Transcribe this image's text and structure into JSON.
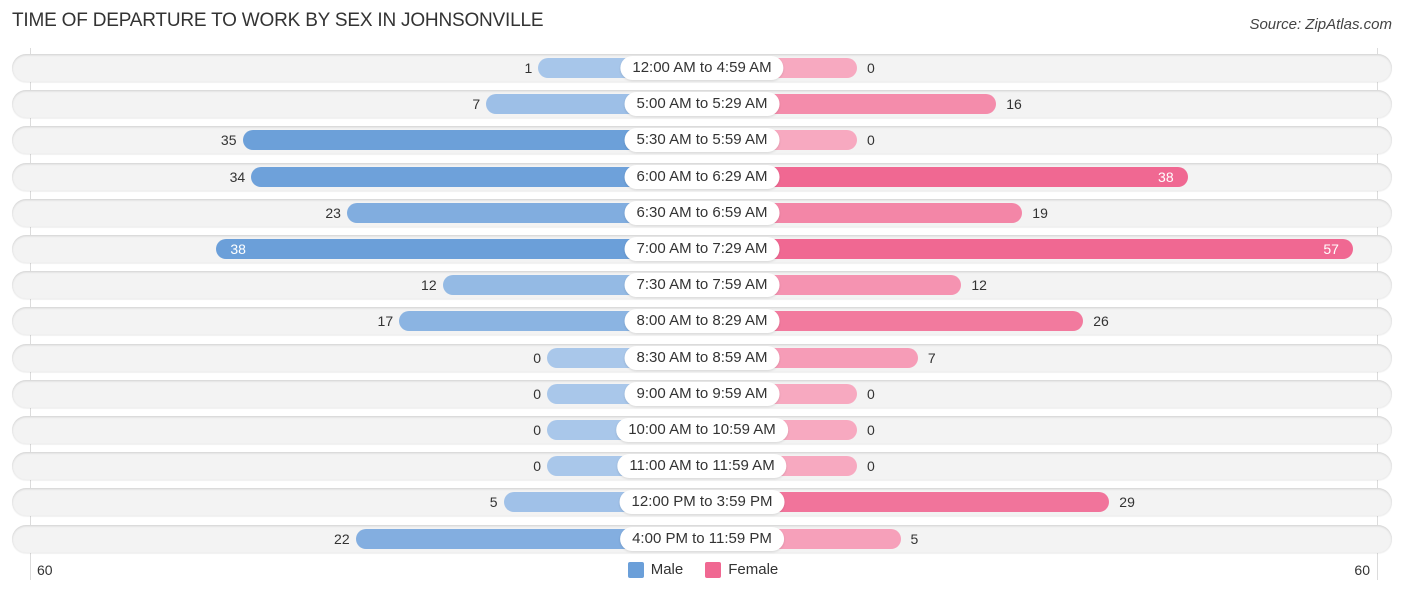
{
  "header": {
    "title": "TIME OF DEPARTURE TO WORK BY SEX IN JOHNSONVILLE",
    "source": "Source: ZipAtlas.com"
  },
  "colors": {
    "male": "#6b9fd9",
    "male_light": "#a9c7ea",
    "female": "#f06892",
    "female_light": "#f7a9c0"
  },
  "chart_data": {
    "type": "bar",
    "orientation": "horizontal-diverging",
    "title": "TIME OF DEPARTURE TO WORK BY SEX IN JOHNSONVILLE",
    "categories": [
      "12:00 AM to 4:59 AM",
      "5:00 AM to 5:29 AM",
      "5:30 AM to 5:59 AM",
      "6:00 AM to 6:29 AM",
      "6:30 AM to 6:59 AM",
      "7:00 AM to 7:29 AM",
      "7:30 AM to 7:59 AM",
      "8:00 AM to 8:29 AM",
      "8:30 AM to 8:59 AM",
      "9:00 AM to 9:59 AM",
      "10:00 AM to 10:59 AM",
      "11:00 AM to 11:59 AM",
      "12:00 PM to 3:59 PM",
      "4:00 PM to 11:59 PM"
    ],
    "series": [
      {
        "name": "Male",
        "values": [
          1,
          7,
          35,
          34,
          23,
          38,
          12,
          17,
          0,
          0,
          0,
          0,
          5,
          22
        ]
      },
      {
        "name": "Female",
        "values": [
          0,
          16,
          0,
          38,
          19,
          57,
          12,
          26,
          7,
          0,
          0,
          0,
          29,
          5
        ]
      }
    ],
    "axis": {
      "left_label": "60",
      "right_label": "60",
      "range": [
        0,
        60
      ]
    },
    "legend": {
      "position": "bottom-center",
      "entries": [
        "Male",
        "Female"
      ]
    },
    "grid": false
  }
}
